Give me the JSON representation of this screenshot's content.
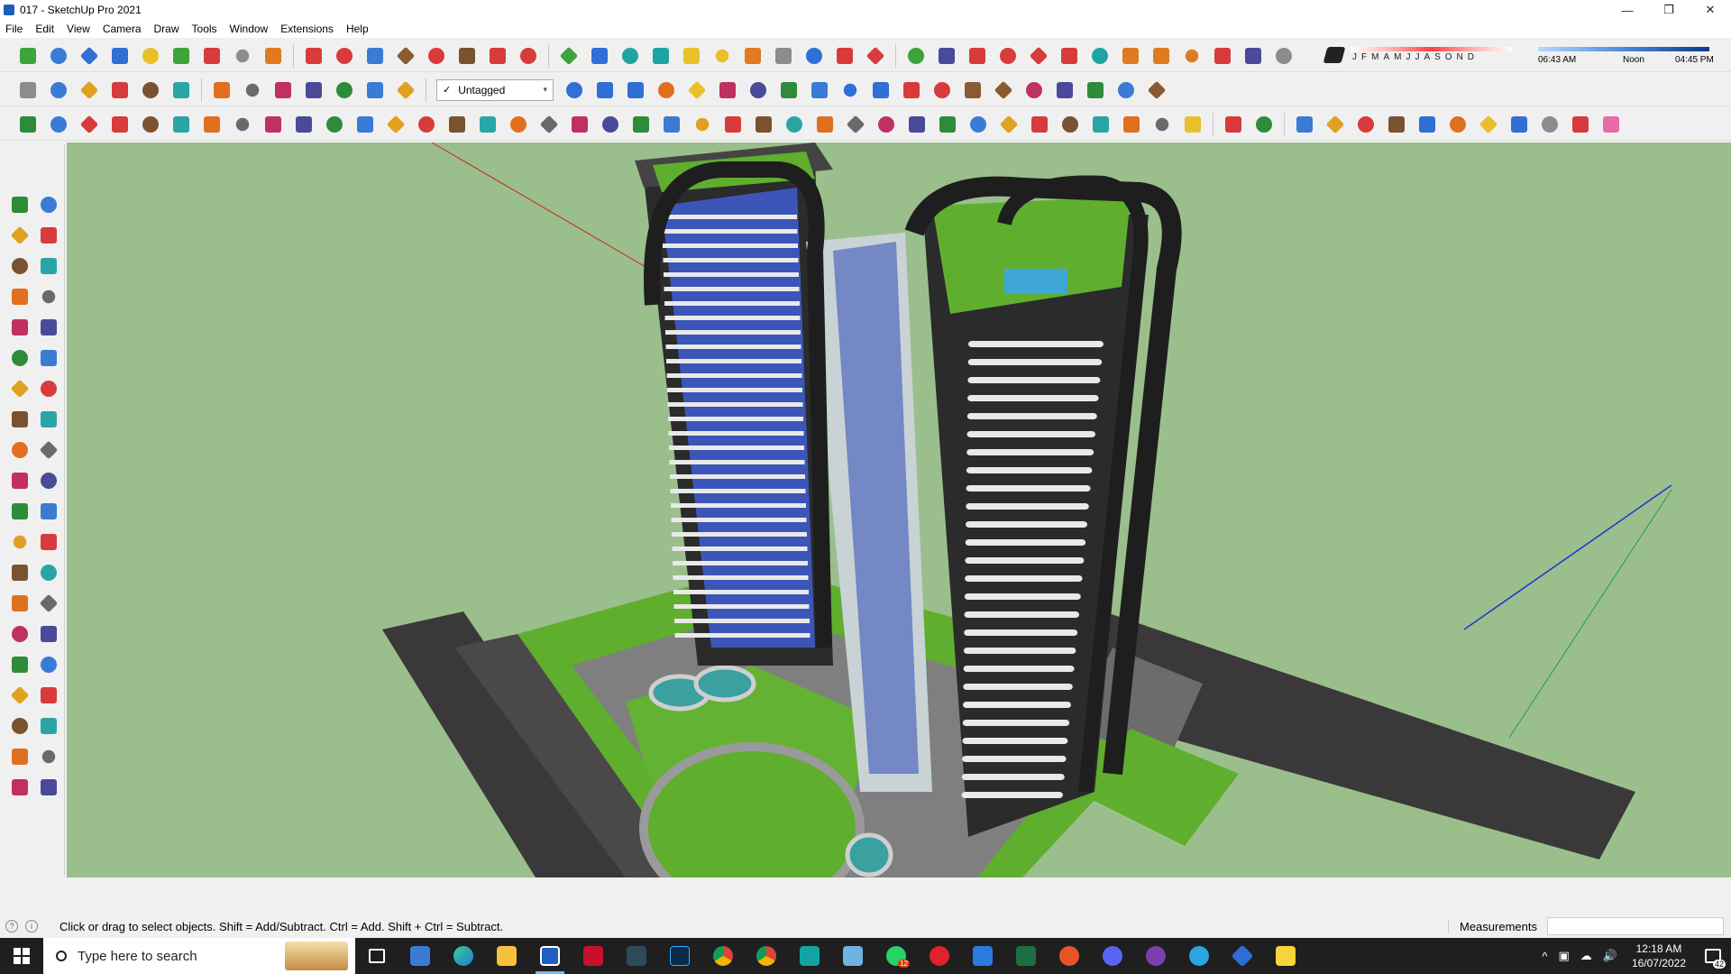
{
  "window": {
    "title": "017 - SketchUp Pro 2021",
    "minimize": "—",
    "maximize": "❐",
    "close": "✕"
  },
  "menu": [
    "File",
    "Edit",
    "View",
    "Camera",
    "Draw",
    "Tools",
    "Window",
    "Extensions",
    "Help"
  ],
  "layer_select": {
    "check": "✓",
    "value": "Untagged",
    "arrow": "▾"
  },
  "shadow": {
    "months": "JFMAMJJASOND",
    "time_start": "06:43 AM",
    "time_mid": "Noon",
    "time_end": "04:45 PM"
  },
  "status": {
    "hint": "Click or drag to select objects. Shift = Add/Subtract. Ctrl = Add. Shift + Ctrl = Subtract.",
    "measurements_label": "Measurements",
    "measurements_value": "",
    "info_icon": "i",
    "geo_icon": "?"
  },
  "taskbar": {
    "search_placeholder": "Type here to search",
    "whatsapp_badge": "12",
    "time": "12:18 AM",
    "date": "16/07/2022",
    "notifications": "42",
    "tray_icons": [
      "^",
      "▣",
      "☁",
      "🔊"
    ]
  },
  "colors": {
    "viewport_bg": "#9bbf8c",
    "grass": "#5fae2e",
    "road": "#3a3838",
    "tower_dark": "#2b2b2b",
    "glass_blue": "#3b56b8",
    "slab_white": "#e9e9e9"
  },
  "toolbar1_icons": [
    "box-green",
    "box-arrow",
    "shape-blue",
    "shape-blue2",
    "shape-yellow",
    "shape-green",
    "shape-red",
    "shape-white",
    "arc-orange",
    "stop-red",
    "grid-red",
    "flag",
    "box-brown",
    "link",
    "curve",
    "node-red",
    "cross-red",
    "cross-green",
    "cross-blue",
    "pyramid-teal",
    "pyramid-teal2",
    "pyramid-yellow",
    "loop-yellow",
    "loop-orange",
    "loop-gray",
    "star-blue",
    "cube-red",
    "u-red",
    "tree-green",
    "cube-gear",
    "cubes-red",
    "cubes-red2",
    "tag-red",
    "gear-grid",
    "frame-teal",
    "grid-orange",
    "grid-orange2",
    "grid-orange3",
    "explode-red",
    "circle-dots",
    "layout-gray"
  ],
  "toolbar2_icons": [
    "cube-gray",
    "cube-house",
    "house",
    "house-outline",
    "house-box",
    "house-open",
    "push-pull",
    "cube-x",
    "cube-r",
    "cube-v",
    "cube-n",
    "cube-x2",
    "cube-f",
    "bar-blue",
    "bar-blue2",
    "bar-blue3",
    "tag-arrow",
    "tag-yellow",
    "t-tool",
    "arrows-up",
    "arrows-down",
    "measure",
    "mirror-blue",
    "undo-blue",
    "redo-red",
    "hand-red",
    "bead-brown",
    "grid-brown",
    "stamp",
    "stamp2",
    "glove",
    "tile",
    "tri-brown"
  ],
  "toolbar3_icons": [
    "pencil-node",
    "pencil-dot",
    "arc-red",
    "scissors",
    "gear-shape",
    "shape2",
    "wrench",
    "lasso",
    "orb",
    "sickle",
    "corner",
    "corner2",
    "knife",
    "sweep",
    "fence",
    "cone",
    "bars",
    "bars2",
    "hand",
    "leaf",
    "fish",
    "stack",
    "fold",
    "fold2",
    "fold3",
    "drum",
    "stairs",
    "door",
    "door2",
    "grid-dark",
    "grid-dark2",
    "grid-dark3",
    "comb",
    "sun",
    "sun2",
    "ramp",
    "ramp2",
    "gem",
    "note-yellow",
    "ruler-red",
    "rect-outline",
    "circle-outline",
    "hex-outline",
    "ellipse-outline",
    "parallelogram",
    "arc-blue",
    "spiral",
    "spiral-yellow",
    "ring-blue",
    "ring-gray",
    "line-red",
    "eraser-pink"
  ],
  "left_icons": [
    [
      "select-arrow",
      "component-cube"
    ],
    [
      "paint-bucket",
      "eraser"
    ],
    [
      "pencil-line",
      "freehand"
    ],
    [
      "rectangle",
      "rotated-rect"
    ],
    [
      "circle",
      "polygon"
    ],
    [
      "arc",
      "arc2"
    ],
    [
      "arc3",
      "pie"
    ],
    [
      "move",
      "push-pull-left"
    ],
    [
      "rotate",
      "follow-me"
    ],
    [
      "scale",
      "offset"
    ],
    [
      "tape-measure",
      "dimension"
    ],
    [
      "protractor",
      "text-tool"
    ],
    [
      "axes",
      "3d-text"
    ],
    [
      "orbit",
      "pan"
    ],
    [
      "zoom",
      "zoom-window"
    ],
    [
      "zoom-extents",
      "zoom-previous"
    ],
    [
      "position-camera",
      "look-around"
    ],
    [
      "walk",
      "section-plane"
    ],
    [
      "sandbox",
      "sandbox2"
    ],
    [
      "stamp-tool",
      "drape"
    ]
  ]
}
